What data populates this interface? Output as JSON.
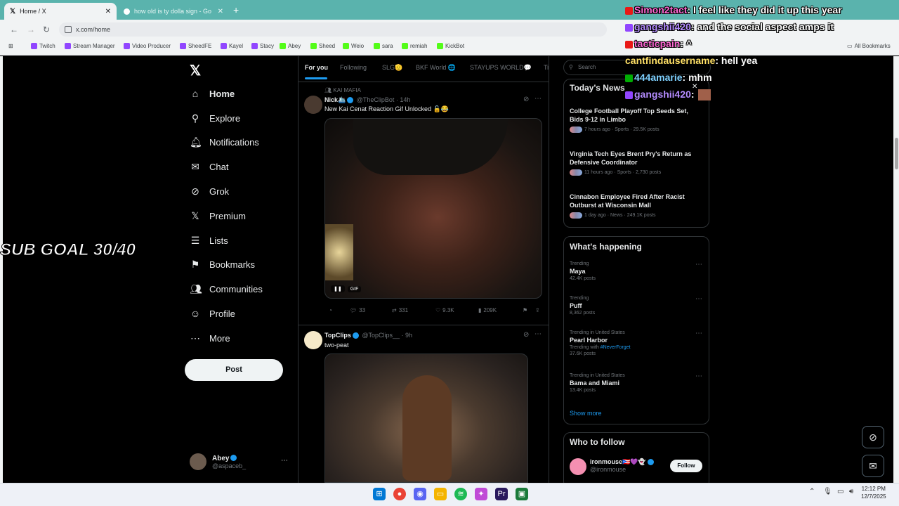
{
  "browser": {
    "tabs": [
      {
        "title": "Home / X",
        "active": true
      },
      {
        "title": "how old is ty dolla sign - Goog",
        "active": false
      }
    ],
    "url": "x.com/home",
    "bookmarks": [
      "Twitch",
      "Stream Manager",
      "Video Producer",
      "SheedFE",
      "Kayel",
      "Stacy",
      "Abey",
      "Sheed",
      "Weio",
      "sara",
      "remiah",
      "KickBot"
    ],
    "all_bookmarks": "All Bookmarks"
  },
  "sidebar": {
    "items": [
      {
        "label": "Home",
        "icon": "home-icon"
      },
      {
        "label": "Explore",
        "icon": "search-icon"
      },
      {
        "label": "Notifications",
        "icon": "bell-icon"
      },
      {
        "label": "Chat",
        "icon": "mail-icon"
      },
      {
        "label": "Grok",
        "icon": "grok-icon"
      },
      {
        "label": "Premium",
        "icon": "x-icon"
      },
      {
        "label": "Lists",
        "icon": "list-icon"
      },
      {
        "label": "Bookmarks",
        "icon": "bookmark-icon"
      },
      {
        "label": "Communities",
        "icon": "communities-icon"
      },
      {
        "label": "Profile",
        "icon": "profile-icon"
      },
      {
        "label": "More",
        "icon": "more-icon"
      }
    ],
    "post_button": "Post",
    "account": {
      "name": "Abey",
      "handle": "@aspaceb_"
    }
  },
  "overlay_goal": "SUB GOAL 30/40",
  "timeline": {
    "tabs": [
      "For you",
      "Following",
      "SLG🫡",
      "BKF World 🌐",
      "STAYUPS WORLD💬",
      "Ti"
    ],
    "posts": [
      {
        "context": "KAI MAFIA",
        "name": "Nick🛳️",
        "handle": "@TheClipBot · 14h",
        "text": "New Kai Cenat Reaction Gif Unlocked 🔓😂",
        "media_badge": "GIF",
        "replies": "33",
        "reposts": "331",
        "likes": "9.3K",
        "views": "209K"
      },
      {
        "name": "TopClips",
        "handle": "@TopClips__ · 9h",
        "text": "two-peat"
      }
    ]
  },
  "right": {
    "search_placeholder": "Search",
    "news_title": "Today's News",
    "news": [
      {
        "title": "College Football Playoff Top Seeds Set, Bids 9-12 in Limbo",
        "meta": "7 hours ago · Sports · 29.5K posts"
      },
      {
        "title": "Virginia Tech Eyes Brent Pry's Return as Defensive Coordinator",
        "meta": "11 hours ago · Sports · 2,730 posts"
      },
      {
        "title": "Cinnabon Employee Fired After Racist Outburst at Wisconsin Mall",
        "meta": "1 day ago · News · 249.1K posts"
      }
    ],
    "happening_title": "What's happening",
    "trends": [
      {
        "category": "Trending",
        "name": "Maya",
        "posts": "42.4K posts"
      },
      {
        "category": "Trending",
        "name": "Puff",
        "posts": "8,362 posts"
      },
      {
        "category": "Trending in United States",
        "name": "Pearl Harbor",
        "with_prefix": "Trending with ",
        "with_tag": "#NeverForget",
        "posts": "37.6K posts"
      },
      {
        "category": "Trending in United States",
        "name": "Bama and Miami",
        "posts": "13.4K posts"
      }
    ],
    "show_more": "Show more",
    "follow_title": "Who to follow",
    "follow": {
      "name": "ironmouse🇵🇷💜👻",
      "handle": "@ironmouse",
      "button": "Follow"
    }
  },
  "chat": [
    {
      "user": "Simon2tact",
      "msg": " I feel like they did it up this year",
      "badge_color": "#e91916"
    },
    {
      "user": "gangshii420",
      "msg": " and the social aspect amps it",
      "badge_color": "#9146ff"
    },
    {
      "user": "tacticpain",
      "msg": " ^",
      "badge_color": "#e91916"
    },
    {
      "user": "cantfindausername",
      "msg": " hell yea",
      "badge_color": ""
    },
    {
      "user": "444amarie",
      "msg": " mhm",
      "badge_color": "#00ad03"
    },
    {
      "user": "gangshii420",
      "msg": " ",
      "badge_color": "#9146ff"
    }
  ],
  "taskbar": {
    "time": "12:12 PM",
    "date": "12/7/2025"
  },
  "colors": {
    "accent": "#1d9bf0",
    "tabbar": "#5ab3ad",
    "background": "#000000"
  }
}
